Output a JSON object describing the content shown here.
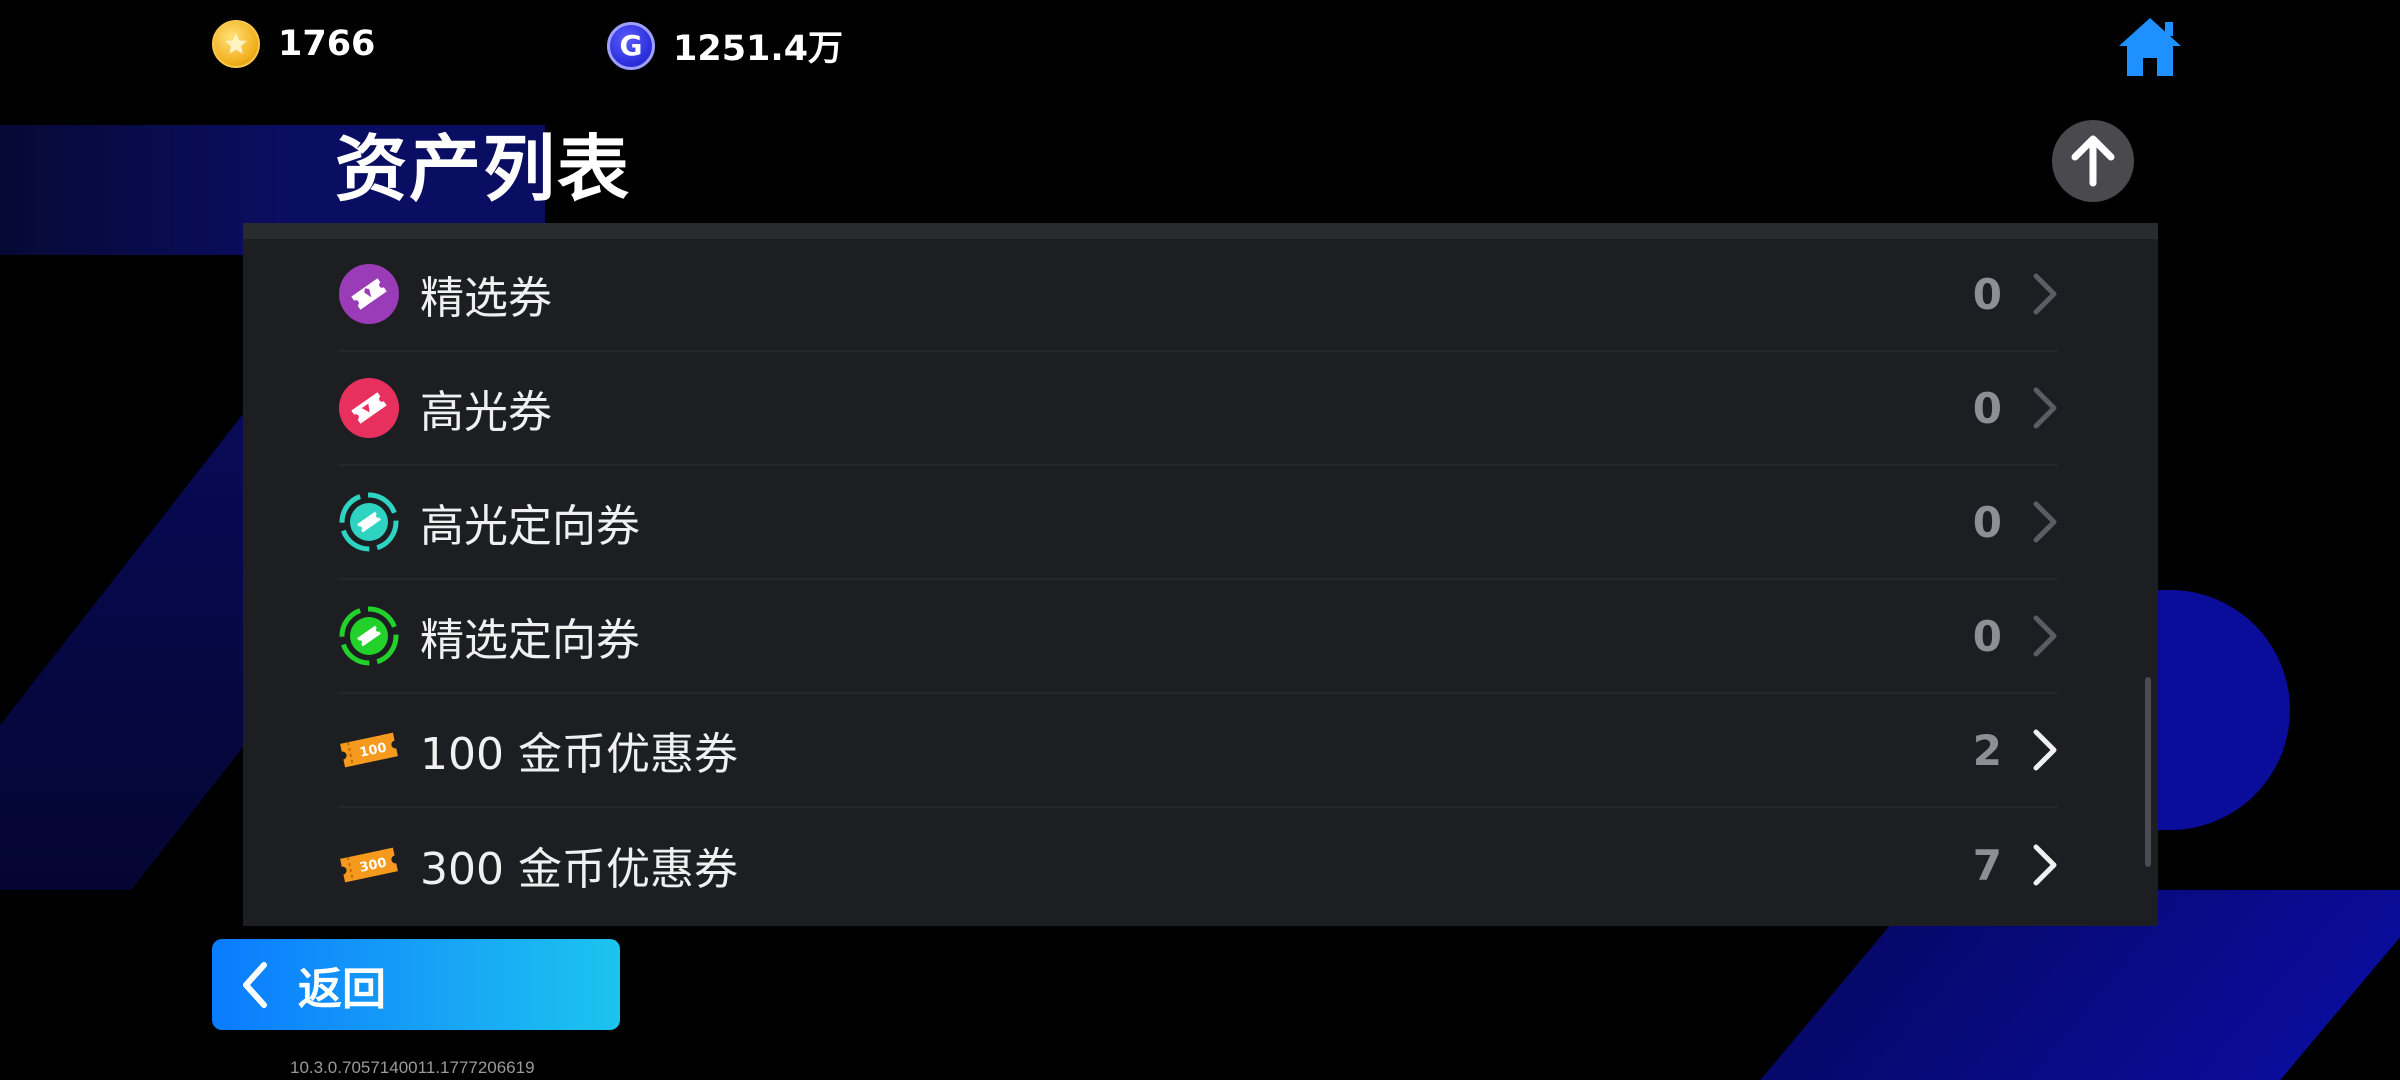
{
  "currency": {
    "gold_coins": "1766",
    "g_coins": "1251.4万",
    "g_symbol": "G"
  },
  "page": {
    "title": "资产列表"
  },
  "assets": [
    {
      "label": "精选券",
      "count": "0",
      "icon": "selected-ticket-icon",
      "enabled": false
    },
    {
      "label": "高光券",
      "count": "0",
      "icon": "highlight-ticket-icon",
      "enabled": false
    },
    {
      "label": "高光定向券",
      "count": "0",
      "icon": "highlight-targeted-ticket-icon",
      "enabled": false
    },
    {
      "label": "精选定向券",
      "count": "0",
      "icon": "selected-targeted-ticket-icon",
      "enabled": false
    },
    {
      "label": "100 金币优惠券",
      "count": "2",
      "icon": "coupon-100-icon",
      "icon_text": "100",
      "enabled": true
    },
    {
      "label": "300 金币优惠券",
      "count": "7",
      "icon": "coupon-300-icon",
      "icon_text": "300",
      "enabled": true
    }
  ],
  "back_button": {
    "label": "返回"
  },
  "version": "10.3.0.7057140011.1777206619",
  "colors": {
    "panel_bg": "#1d1e22",
    "back_gradient_start": "#0a7bff",
    "back_gradient_end": "#1cc4ee",
    "home_icon": "#1e90ff"
  }
}
